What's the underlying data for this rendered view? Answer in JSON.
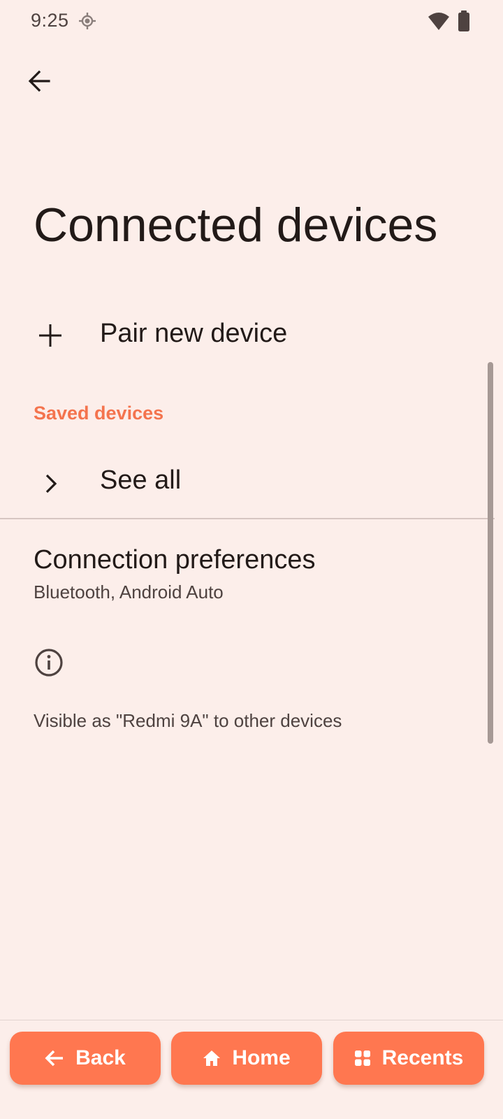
{
  "status_bar": {
    "time": "9:25",
    "icons": [
      "location-icon",
      "wifi-icon",
      "battery-icon"
    ]
  },
  "header": {
    "back_icon": "arrow-left-icon",
    "title": "Connected devices"
  },
  "pair_new": {
    "icon": "plus-icon",
    "label": "Pair new device"
  },
  "saved_devices": {
    "header": "Saved devices",
    "see_all_icon": "chevron-right-icon",
    "see_all_label": "See all"
  },
  "connection_preferences": {
    "title": "Connection preferences",
    "summary": "Bluetooth, Android Auto"
  },
  "footer": {
    "icon": "info-icon",
    "text": "Visible as \"Redmi 9A\" to other devices"
  },
  "nav_bar": {
    "back_label": "Back",
    "home_label": "Home",
    "recents_label": "Recents"
  },
  "colors": {
    "background": "#FCEEEA",
    "accent": "#F4744E",
    "nav_button": "#FF7750",
    "text_primary": "#221A18",
    "text_secondary": "#4E4240"
  }
}
